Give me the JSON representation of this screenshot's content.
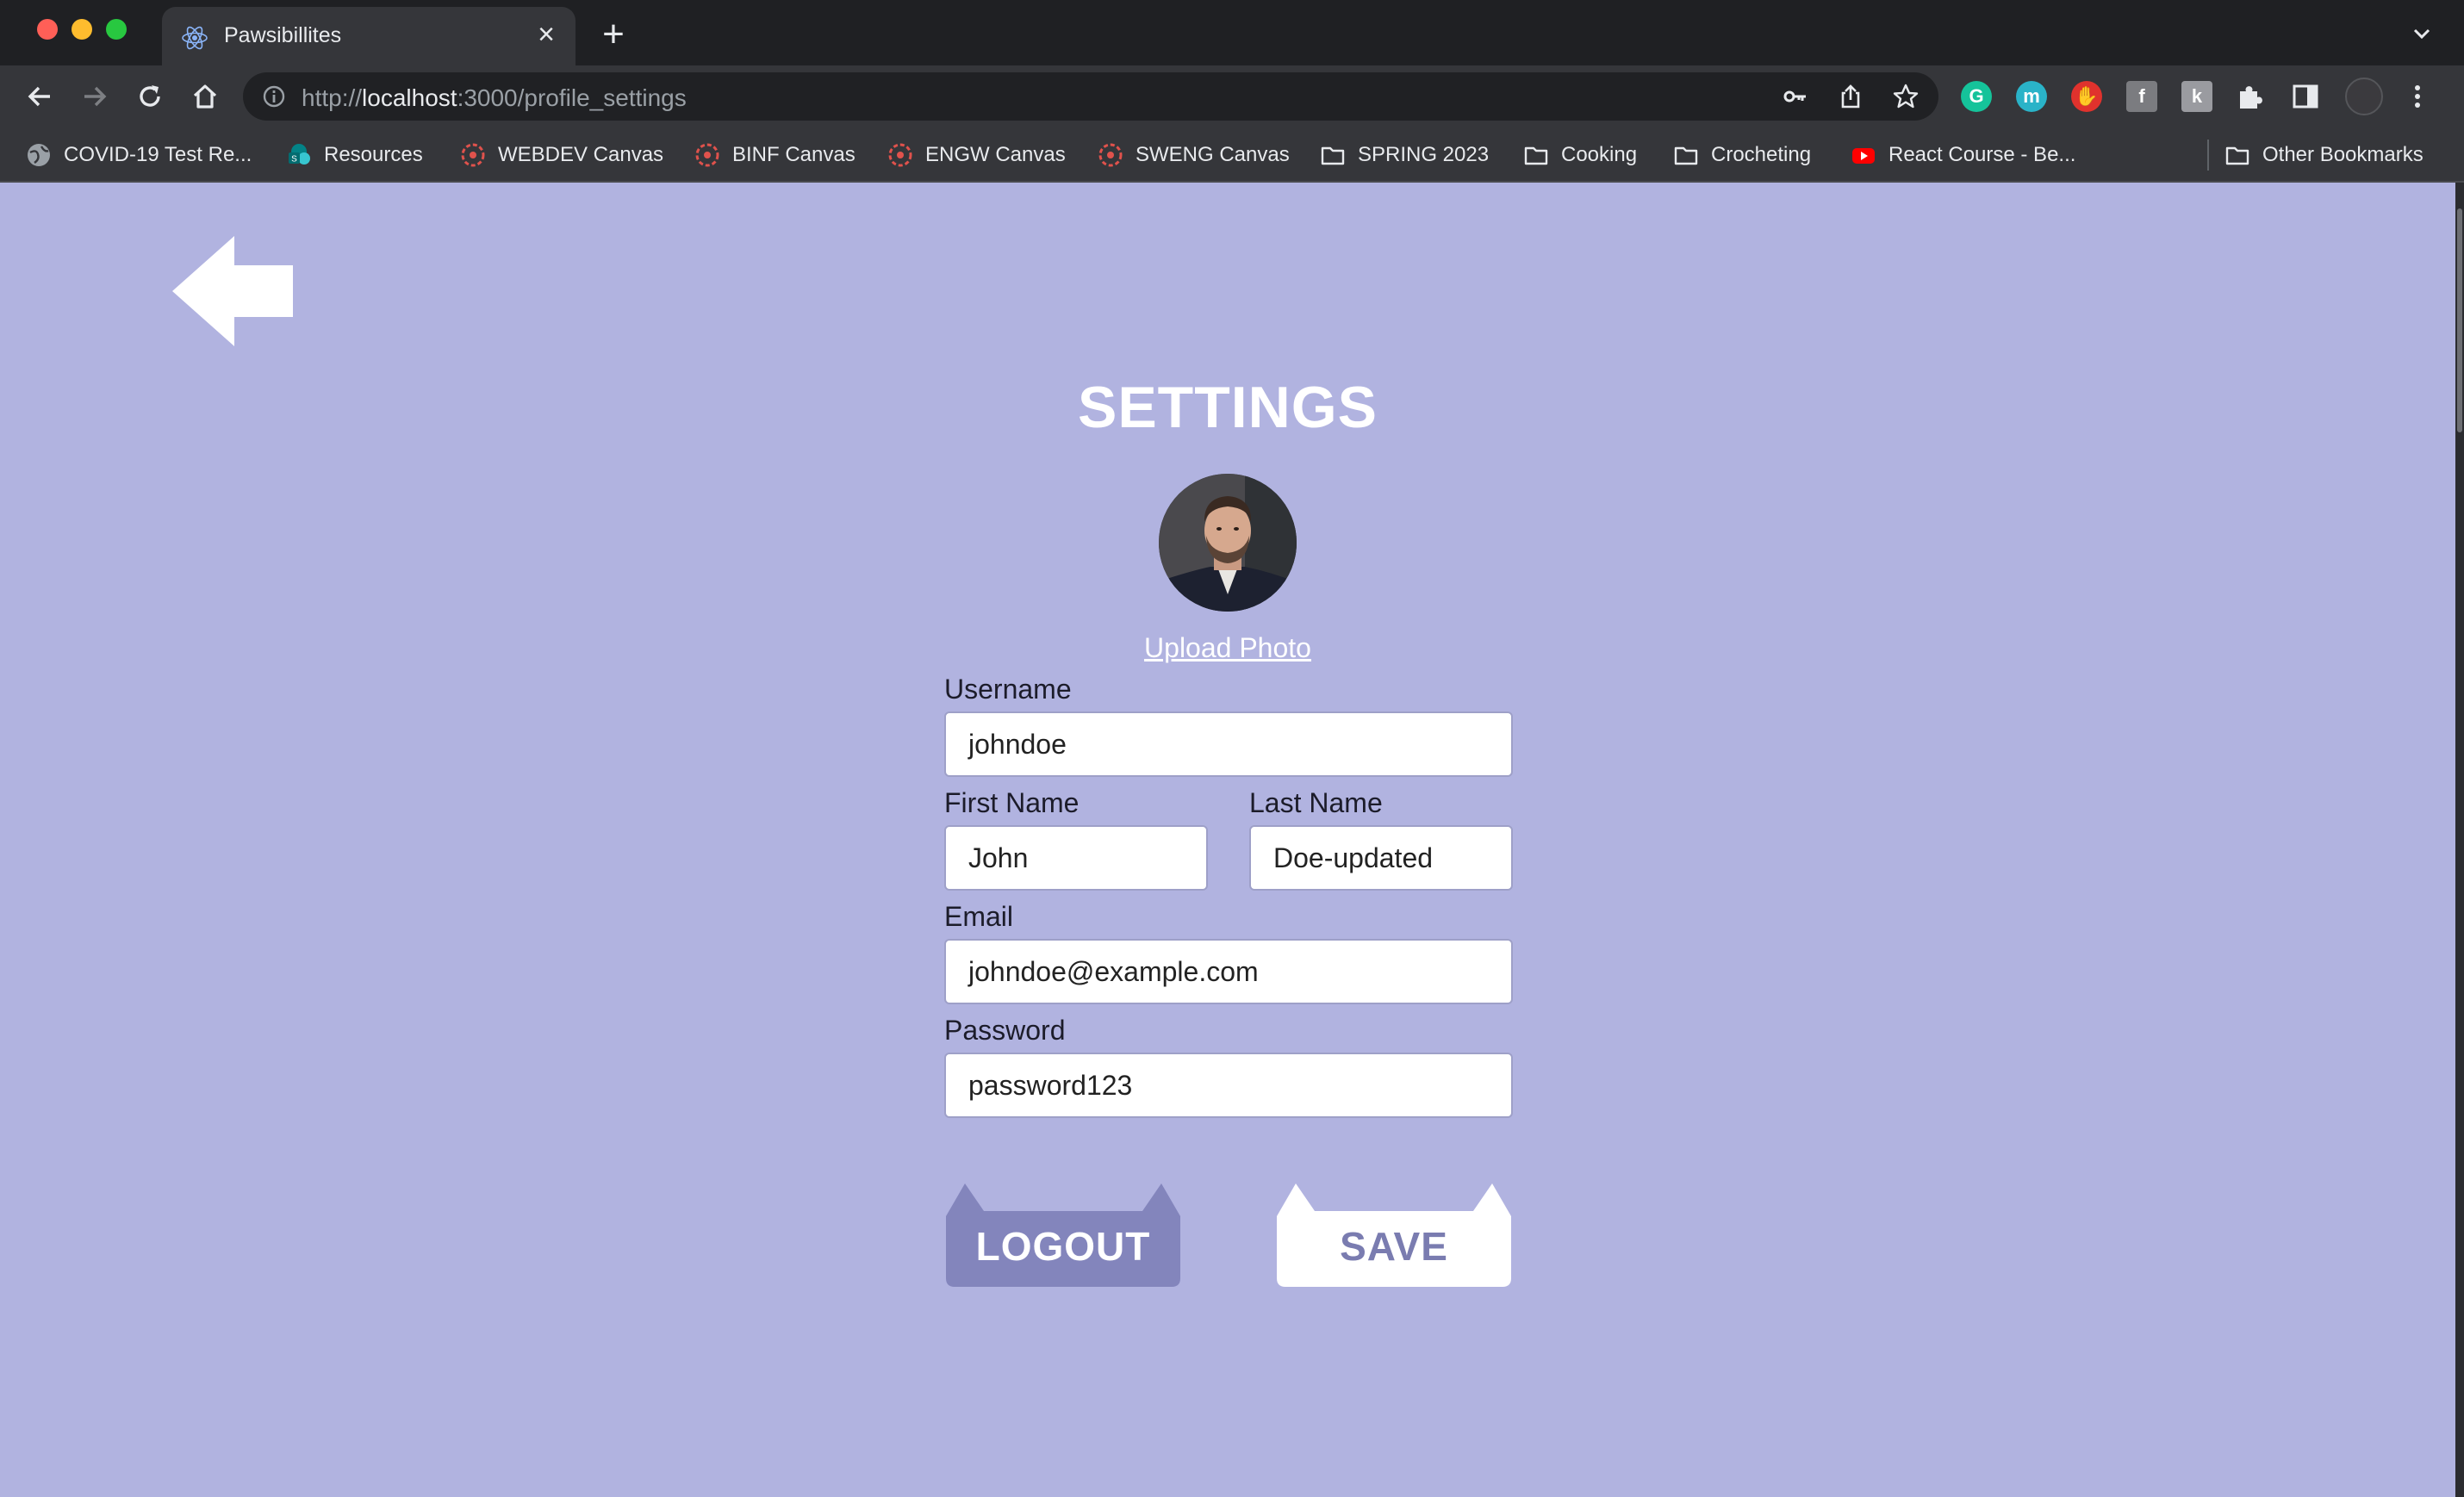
{
  "browser": {
    "tab_title": "Pawsibillites",
    "url_scheme": "http://",
    "url_host": "localhost",
    "url_rest": ":3000/profile_settings",
    "bookmarks": [
      {
        "label": "COVID-19 Test Re...",
        "icon": "globe-icon"
      },
      {
        "label": "Resources",
        "icon": "sharepoint-icon"
      },
      {
        "label": "WEBDEV Canvas",
        "icon": "canvas-icon"
      },
      {
        "label": "BINF Canvas",
        "icon": "canvas-icon"
      },
      {
        "label": "ENGW Canvas",
        "icon": "canvas-icon"
      },
      {
        "label": "SWENG Canvas",
        "icon": "canvas-icon"
      },
      {
        "label": "SPRING 2023",
        "icon": "folder-icon"
      },
      {
        "label": "Cooking",
        "icon": "folder-icon"
      },
      {
        "label": "Crocheting",
        "icon": "folder-icon"
      },
      {
        "label": "React Course - Be...",
        "icon": "youtube-icon"
      }
    ],
    "other_bookmarks": "Other Bookmarks"
  },
  "settings": {
    "title": "SETTINGS",
    "upload_photo": "Upload Photo",
    "username_label": "Username",
    "username_value": "johndoe",
    "first_name_label": "First Name",
    "first_name_value": "John",
    "last_name_label": "Last Name",
    "last_name_value": "Doe-updated",
    "email_label": "Email",
    "email_value": "johndoe@example.com",
    "password_label": "Password",
    "password_value": "password123",
    "logout_label": "LOGOUT",
    "save_label": "SAVE"
  },
  "colors": {
    "page_background": "#b1b3e0",
    "logout_button": "#8385bc",
    "save_button": "#ffffff",
    "save_text": "#7a7cb0"
  }
}
